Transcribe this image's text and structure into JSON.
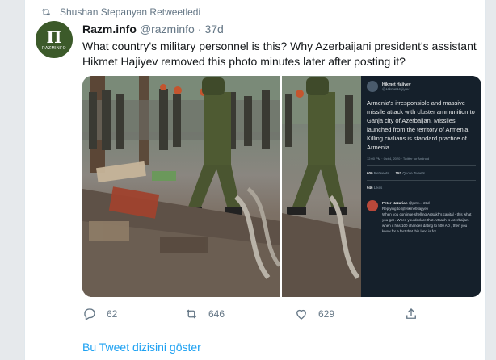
{
  "retweet_banner": {
    "text": "Shushan Stepanyan Retweetledi",
    "icon": "retweet-icon"
  },
  "tweet": {
    "avatar_icon": "razm-logo",
    "display_name": "Razm.info",
    "handle": "@razminfo",
    "separator": "·",
    "time": "37d",
    "text": "What country's military personnel is this? Why Azerbaijani president's assistant Hikmet Hajiyev removed this photo minutes later after posting it?"
  },
  "media": {
    "embedded_tweet": {
      "name": "Hikmet Hajiyev",
      "handle": "@HikmetHajiyev",
      "text": "Armenia's irresponsible and massive missile attack with cluster ammunition to Ganja city of Azerbaijan. Missiles launched from the territory of Armenia. Killing civilians is standard practice of Armenia.",
      "meta": "12:00 PM · Oct 4, 2020 · Twitter for Android",
      "retweets_count": "600",
      "retweets_label": "Retweets",
      "quotes_count": "152",
      "quotes_label": "Quote Tweets",
      "likes_count": "946",
      "likes_label": "Likes",
      "reply": {
        "name": "Petor Nazarian",
        "handle": "@pete...",
        "time": "23d",
        "replying_to": "Replying to @HikmetHajiyev",
        "text": "When you continue shelling Artsakh's capital - this what you get . When you declare that Artsakh is Azerbaijan when it has 100 chances dating to 500 AD , then you know for a fact that this land is for"
      }
    }
  },
  "actions": {
    "reply": {
      "icon": "reply-icon",
      "count": "62"
    },
    "retweet": {
      "icon": "retweet-icon",
      "count": "646"
    },
    "like": {
      "icon": "heart-icon",
      "count": "629"
    },
    "share": {
      "icon": "share-icon"
    }
  },
  "show_thread": "Bu Tweet dizisini göster",
  "colors": {
    "link": "#1da1f2",
    "muted": "#657786",
    "text": "#14171a",
    "dim_bg": "#15202b"
  }
}
